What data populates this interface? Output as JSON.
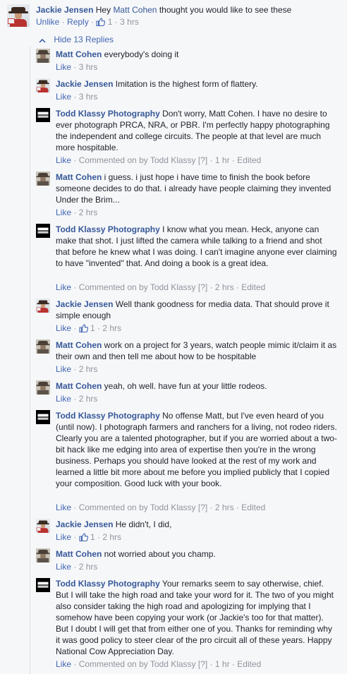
{
  "top_comment": {
    "author": "Jackie Jensen",
    "text_before": "Hey",
    "mention": "Matt Cohen",
    "text_after": "thought you would like to see these",
    "unlike": "Unlike",
    "reply": "Reply",
    "likes": "1",
    "time": "3 hrs"
  },
  "hide_replies_label": "Hide 13 Replies",
  "replies": [
    {
      "author": "Matt Cohen",
      "text": "everybody's doing it",
      "like": "Like",
      "likes": "",
      "time": "3 hrs",
      "commented_on_by": "",
      "edited": ""
    },
    {
      "author": "Jackie Jensen",
      "text": "Imitation is the highest form of flattery.",
      "like": "Like",
      "likes": "",
      "time": "3 hrs",
      "commented_on_by": "",
      "edited": ""
    },
    {
      "author": "Todd Klassy Photography",
      "text": "Don't worry, Matt Cohen. I have no desire to ever photograph PRCA, NRA, or PBR. I'm perfectly happy photographing the independent and college circuits. The people at that level are much more hospitable.",
      "like": "Like",
      "likes": "",
      "time": "1 hr",
      "commented_on_by": "Commented on by Todd Klassy [?]",
      "edited": "Edited"
    },
    {
      "author": "Matt Cohen",
      "text": "i guess. i just hope i have time to finish the book before someone decides to do that. i already have people claiming they invented Under the Brim...",
      "like": "Like",
      "likes": "",
      "time": "2 hrs",
      "commented_on_by": "",
      "edited": ""
    },
    {
      "author": "Todd Klassy Photography",
      "text": "I know what you mean. Heck, anyone can make that shot. I just lifted the camera while talking to a friend and shot that before he knew what I was doing. I can't imagine anyone ever claiming to have \"invented\" that. And doing a book is a great idea.",
      "like": "Like",
      "likes": "",
      "time": "2 hrs",
      "commented_on_by": "Commented on by Todd Klassy [?]",
      "edited": "Edited"
    },
    {
      "author": "Jackie Jensen",
      "text": "Well thank goodness for media data. That should prove it simple enough",
      "like": "Like",
      "likes": "1",
      "time": "2 hrs",
      "commented_on_by": "",
      "edited": ""
    },
    {
      "author": "Matt Cohen",
      "text": "work on a project for 3 years, watch people mimic it/claim it as their own and then tell me about how to be hospitable",
      "like": "Like",
      "likes": "",
      "time": "2 hrs",
      "commented_on_by": "",
      "edited": ""
    },
    {
      "author": "Matt Cohen",
      "text": "yeah, oh well. have fun at your little rodeos.",
      "like": "Like",
      "likes": "",
      "time": "2 hrs",
      "commented_on_by": "",
      "edited": ""
    },
    {
      "author": "Todd Klassy Photography",
      "text": "No offense Matt, but I've even heard of you (until now). I photograph farmers and ranchers for a living, not rodeo riders. Clearly you are a talented photographer, but if you are worried about a two-bit hack like me edging into area of expertise then you're in the wrong business. Perhaps you should have looked at the rest of my work and learned a little bit more about me before you implied publicly that I copied your composition. Good luck with your book.",
      "like": "Like",
      "likes": "",
      "time": "2 hrs",
      "commented_on_by": "Commented on by Todd Klassy [?]",
      "edited": "Edited"
    },
    {
      "author": "Jackie Jensen",
      "text": "He didn't, I did,",
      "like": "Like",
      "likes": "1",
      "time": "2 hrs",
      "commented_on_by": "",
      "edited": ""
    },
    {
      "author": "Matt Cohen",
      "text": "not worried about you champ.",
      "like": "Like",
      "likes": "",
      "time": "2 hrs",
      "commented_on_by": "",
      "edited": ""
    },
    {
      "author": "Todd Klassy Photography",
      "text": "Your remarks seem to say otherwise, chief. But I will take the high road and take your word for it. The two of you might also consider taking the high road and apologizing for implying that I somehow have been copying your work (or Jackie's too for that matter). But I doubt I will get that from either one of you. Thanks for reminding why it was good policy to steer clear of the pro circuit all of these years. Happy National Cow Appreciation Day.",
      "like": "Like",
      "likes": "",
      "time": "1 hr",
      "commented_on_by": "Commented on by Todd Klassy [?]",
      "edited": "Edited"
    }
  ],
  "icons": {
    "like": "thumbs-up-icon",
    "collapse": "chevron-up-icon"
  },
  "colors": {
    "link": "#365899",
    "action": "#4267b2",
    "meta": "#90949c",
    "text": "#1d2129",
    "background": "#f6f7f9"
  }
}
